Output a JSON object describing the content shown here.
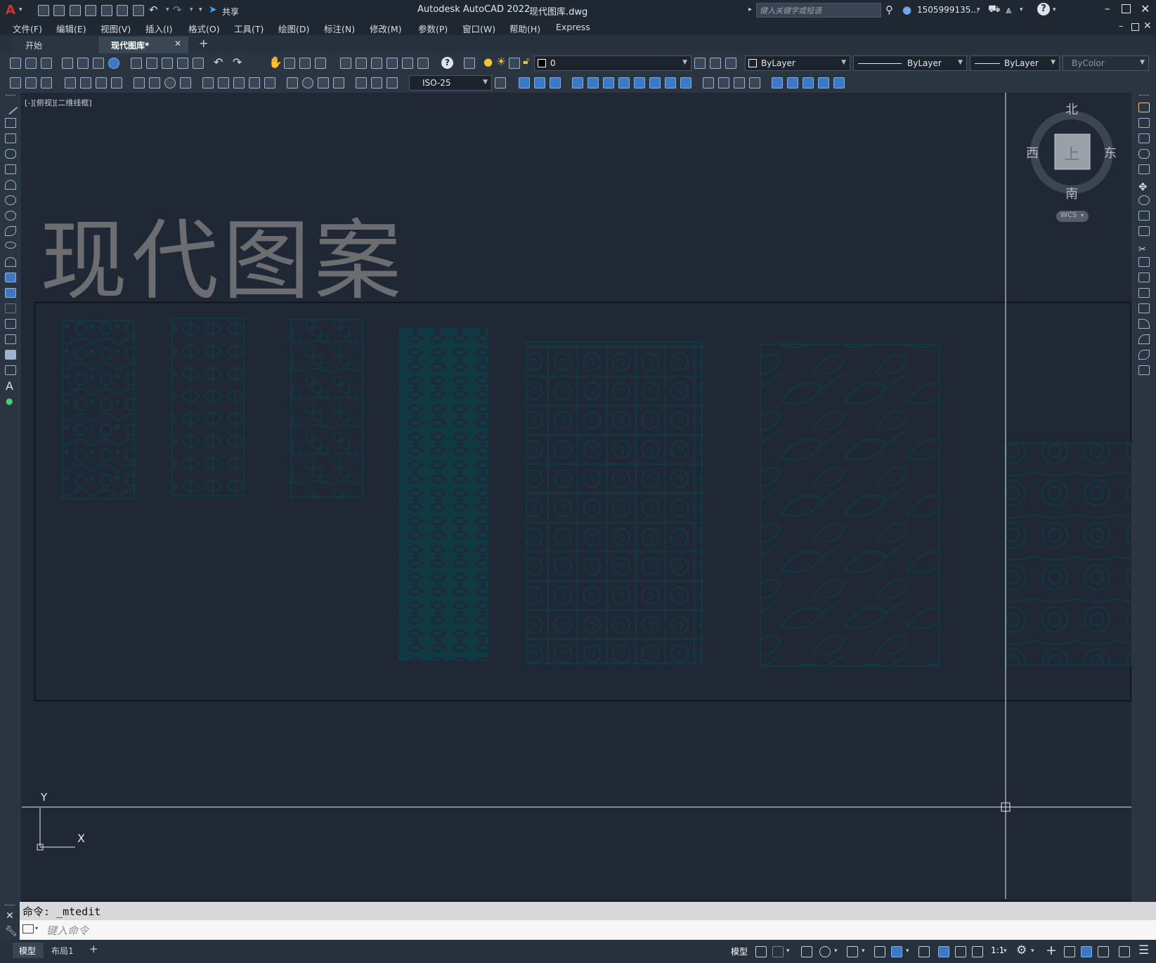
{
  "app": {
    "title": "Autodesk AutoCAD 2022",
    "file": "现代图库.dwg",
    "share_label": "共享",
    "search_placeholder": "键入关键字或短语",
    "user": "1505999135...",
    "logo_letter": "A"
  },
  "menu": [
    "文件(F)",
    "编辑(E)",
    "视图(V)",
    "插入(I)",
    "格式(O)",
    "工具(T)",
    "绘图(D)",
    "标注(N)",
    "修改(M)",
    "参数(P)",
    "窗口(W)",
    "帮助(H)",
    "Express"
  ],
  "tabs": {
    "start": "开始",
    "active": "现代图库*",
    "close": "✕",
    "add": "+"
  },
  "toolbar": {
    "layer_value": "0",
    "color_value": "ByLayer",
    "linetype_value": "ByLayer",
    "lineweight_value": "ByLayer",
    "plotstyle_value": "ByColor",
    "dimstyle_value": "ISO-25"
  },
  "viewport": {
    "label": "[-][俯视][二维线框]",
    "drawing_title": "现代图案",
    "viewcube": {
      "north": "北",
      "south": "南",
      "east": "东",
      "west": "西",
      "top": "上",
      "wcs": "WCS"
    },
    "ucs": {
      "x": "X",
      "y": "Y"
    }
  },
  "command": {
    "history": "命令:  _mtedit",
    "placeholder": "键入命令"
  },
  "layout_tabs": [
    "模型",
    "布局1",
    "+"
  ],
  "status": {
    "model": "模型",
    "scale": "1:1"
  },
  "colors": {
    "canvas": "#212835",
    "pattern": "#0f3a44",
    "title_text": "#6b6d70"
  }
}
